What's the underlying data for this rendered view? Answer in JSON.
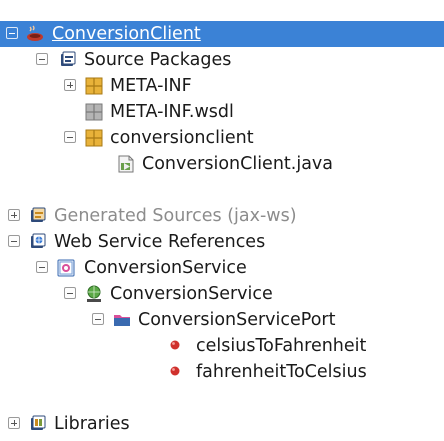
{
  "tree": {
    "project": {
      "label": "ConversionClient",
      "icon": "coffee-cup-icon"
    },
    "source_packages": {
      "label": "Source Packages",
      "icon": "source-packages-icon"
    },
    "meta_inf": {
      "label": "META-INF",
      "icon": "package-icon"
    },
    "meta_inf_wsdl": {
      "label": "META-INF.wsdl",
      "icon": "empty-package-icon"
    },
    "conversionclient_pkg": {
      "label": "conversionclient",
      "icon": "package-icon"
    },
    "conversionclient_java": {
      "label": "ConversionClient.java",
      "icon": "java-file-icon"
    },
    "generated_sources": {
      "label": "Generated Sources (jax-ws)",
      "icon": "generated-sources-icon"
    },
    "web_service_refs": {
      "label": "Web Service References",
      "icon": "web-service-references-icon"
    },
    "conversion_service_ref": {
      "label": "ConversionService",
      "icon": "web-service-icon"
    },
    "conversion_service": {
      "label": "ConversionService",
      "icon": "service-globe-icon"
    },
    "conversion_service_port": {
      "label": "ConversionServicePort",
      "icon": "port-folder-icon"
    },
    "op_celsius": {
      "label": "celsiusToFahrenheit",
      "icon": "operation-bullet-icon"
    },
    "op_fahrenheit": {
      "label": "fahrenheitToCelsius",
      "icon": "operation-bullet-icon"
    },
    "libraries": {
      "label": "Libraries",
      "icon": "libraries-icon"
    }
  },
  "colors": {
    "selection": "#3b82d6",
    "package": "#e8b23a",
    "operation": "#d0312d"
  }
}
